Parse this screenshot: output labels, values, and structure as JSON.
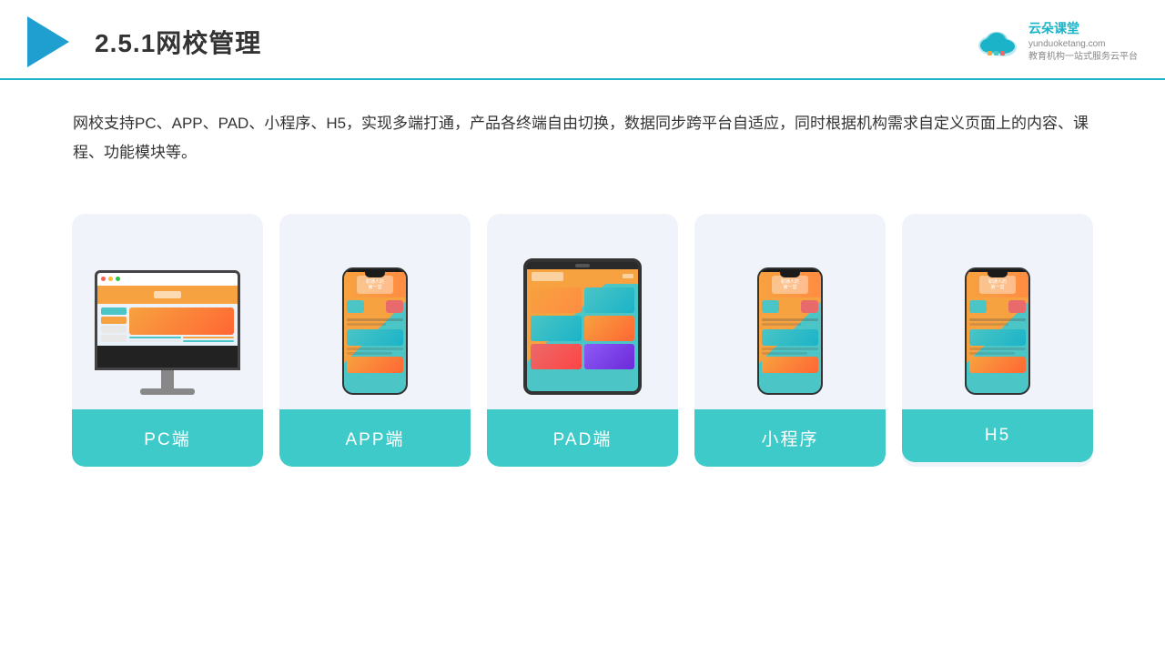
{
  "header": {
    "section_number": "2.5.1",
    "title": "网校管理",
    "brand": {
      "name": "云朵课堂",
      "domain": "yunduoketang.com",
      "tagline1": "教育机构一站",
      "tagline2": "式服务云平台"
    }
  },
  "description": {
    "text": "网校支持PC、APP、PAD、小程序、H5，实现多端打通，产品各终端自由切换，数据同步跨平台自适应，同时根据机构需求自定义页面上的内容、课程、功能模块等。"
  },
  "devices": [
    {
      "id": "pc",
      "label": "PC端",
      "type": "pc"
    },
    {
      "id": "app",
      "label": "APP端",
      "type": "phone"
    },
    {
      "id": "pad",
      "label": "PAD端",
      "type": "tablet"
    },
    {
      "id": "mini",
      "label": "小程序",
      "type": "phone"
    },
    {
      "id": "h5",
      "label": "H5",
      "type": "phone"
    }
  ]
}
